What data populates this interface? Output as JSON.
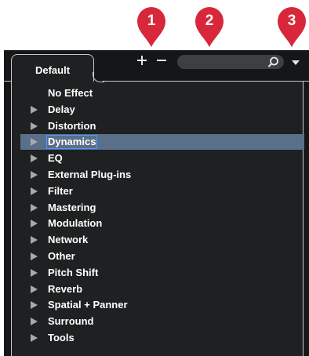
{
  "callouts": [
    "1",
    "2",
    "3"
  ],
  "colors": {
    "pin": "#d8273a",
    "panel": "#1f2021",
    "selection": "#5a6f8a"
  },
  "tabs": [
    {
      "label": "Default"
    }
  ],
  "toolbar": {
    "add_icon": "plus-icon",
    "remove_icon": "minus-icon",
    "search_icon": "search-icon",
    "menu_icon": "chevron-down-icon"
  },
  "search": {
    "value": "",
    "placeholder": ""
  },
  "effects": [
    {
      "label": "No Effect",
      "has_children": false,
      "selected": false
    },
    {
      "label": "Delay",
      "has_children": true,
      "selected": false
    },
    {
      "label": "Distortion",
      "has_children": true,
      "selected": false
    },
    {
      "label": "Dynamics",
      "has_children": true,
      "selected": true
    },
    {
      "label": "EQ",
      "has_children": true,
      "selected": false
    },
    {
      "label": "External Plug-ins",
      "has_children": true,
      "selected": false
    },
    {
      "label": "Filter",
      "has_children": true,
      "selected": false
    },
    {
      "label": "Mastering",
      "has_children": true,
      "selected": false
    },
    {
      "label": "Modulation",
      "has_children": true,
      "selected": false
    },
    {
      "label": "Network",
      "has_children": true,
      "selected": false
    },
    {
      "label": "Other",
      "has_children": true,
      "selected": false
    },
    {
      "label": "Pitch Shift",
      "has_children": true,
      "selected": false
    },
    {
      "label": "Reverb",
      "has_children": true,
      "selected": false
    },
    {
      "label": "Spatial + Panner",
      "has_children": true,
      "selected": false
    },
    {
      "label": "Surround",
      "has_children": true,
      "selected": false
    },
    {
      "label": "Tools",
      "has_children": true,
      "selected": false
    }
  ]
}
